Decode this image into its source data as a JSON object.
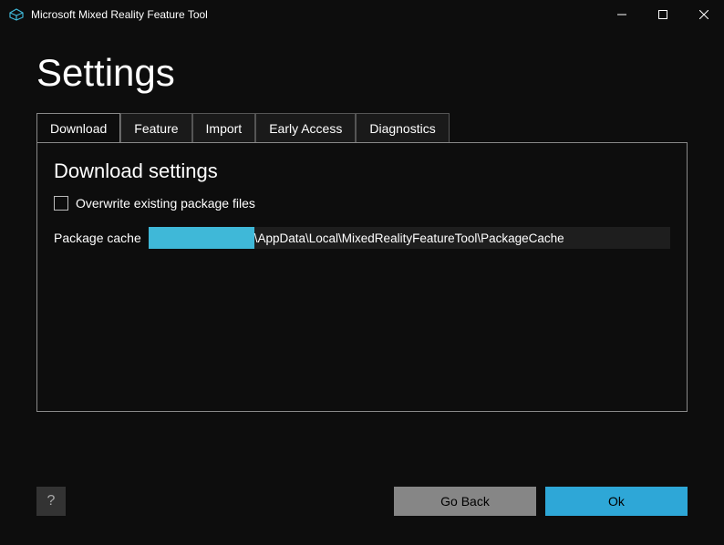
{
  "titleBar": {
    "title": "Microsoft Mixed Reality Feature Tool"
  },
  "heading": "Settings",
  "tabs": [
    {
      "label": "Download",
      "active": true
    },
    {
      "label": "Feature",
      "active": false
    },
    {
      "label": "Import",
      "active": false
    },
    {
      "label": "Early Access",
      "active": false
    },
    {
      "label": "Diagnostics",
      "active": false
    }
  ],
  "section": {
    "heading": "Download settings",
    "overwriteCheckbox": {
      "label": "Overwrite existing package files",
      "checked": false
    },
    "packageCache": {
      "label": "Package cache",
      "visiblePath": "\\AppData\\Local\\MixedRealityFeatureTool\\PackageCache"
    }
  },
  "footer": {
    "help": "?",
    "goBack": "Go Back",
    "ok": "Ok"
  }
}
